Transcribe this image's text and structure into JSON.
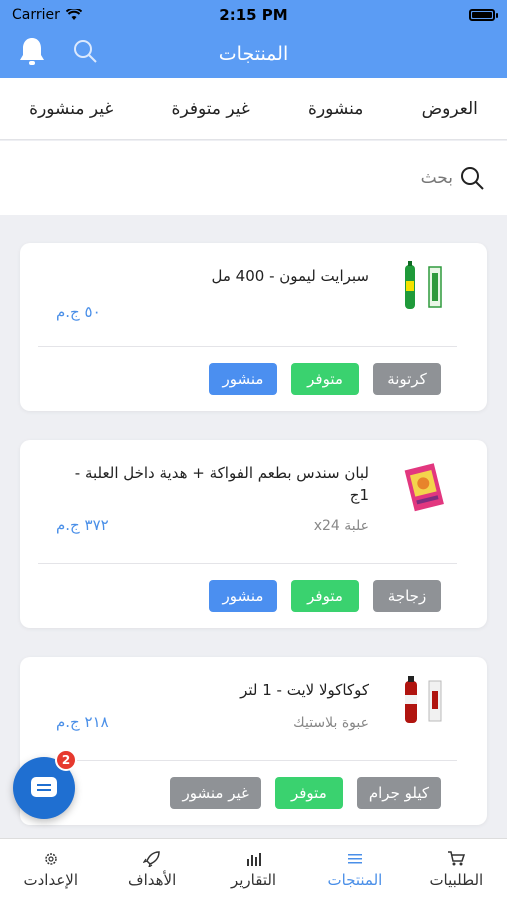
{
  "status_bar": {
    "carrier": "Carrier",
    "time": "2:15 PM"
  },
  "navbar": {
    "title": "المنتجات"
  },
  "tabs": [
    {
      "label": "العروض"
    },
    {
      "label": "منشورة"
    },
    {
      "label": "غير متوفرة"
    },
    {
      "label": "غير منشورة"
    }
  ],
  "search": {
    "placeholder": "بحث"
  },
  "products": [
    {
      "name": "سبرايت ليمون - 400 مل",
      "sub": "",
      "price": "٥٠ ج.م",
      "badges": {
        "unit": "كرتونة",
        "availability": "متوفر",
        "publish": "منشور"
      }
    },
    {
      "name": "لبان سندس بطعم الفواكة + هدية داخل العلبة - 1ج",
      "sub": "علبة x24",
      "price": "٣٧٢ ج.م",
      "badges": {
        "unit": "زجاجة",
        "availability": "متوفر",
        "publish": "منشور"
      }
    },
    {
      "name": "كوكاكولا لايت - 1 لتر",
      "sub": "عبوة بلاستيك",
      "price": "٢١٨ ج.م",
      "badges": {
        "unit": "كيلو جرام",
        "availability": "متوفر",
        "publish": "غير منشور"
      }
    }
  ],
  "chat": {
    "count": "2"
  },
  "bottom_nav": [
    {
      "label": "الطلبيات",
      "icon": "cart-icon"
    },
    {
      "label": "المنتجات",
      "icon": "list-icon"
    },
    {
      "label": "التقارير",
      "icon": "bar-chart-icon"
    },
    {
      "label": "الأهداف",
      "icon": "rocket-icon"
    },
    {
      "label": "الإعدادت",
      "icon": "gear-icon"
    }
  ],
  "colors": {
    "primary": "#5b9cf4",
    "accent": "#4a8fe8",
    "available": "#3ad26f",
    "published": "#4b8ff0",
    "unit": "#8f9296",
    "notification": "#e6392e"
  }
}
